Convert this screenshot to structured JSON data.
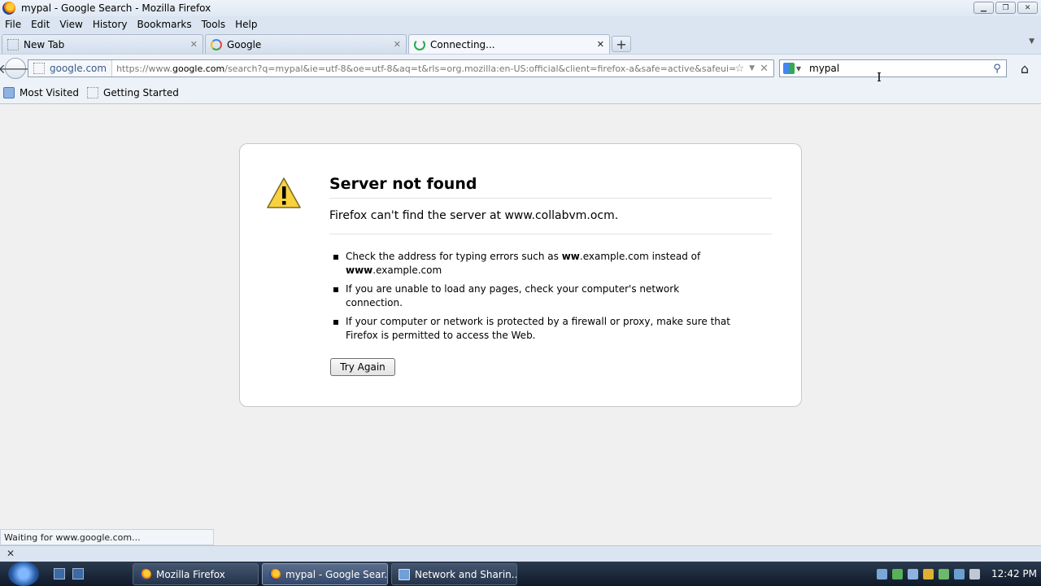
{
  "window": {
    "title": "mypal - Google Search - Mozilla Firefox"
  },
  "menu": [
    "File",
    "Edit",
    "View",
    "History",
    "Bookmarks",
    "Tools",
    "Help"
  ],
  "tabs": [
    {
      "label": "New Tab",
      "icon": "blank-page-icon"
    },
    {
      "label": "Google",
      "icon": "google-favicon-icon"
    },
    {
      "label": "Connecting...",
      "icon": "loading-spinner-icon",
      "active": true
    }
  ],
  "nav": {
    "site_identity": "google.com",
    "url_prefix": "https://www.",
    "url_domain": "google.com",
    "url_rest": "/search?q=mypal&ie=utf-8&oe=utf-8&aq=t&rls=org.mozilla:en-US:official&client=firefox-a&safe=active&safeui=or",
    "search_value": "mypal"
  },
  "bookmarks": [
    "Most Visited",
    "Getting Started"
  ],
  "error": {
    "title": "Server not found",
    "description": "Firefox can't find the server at www.collabvm.ocm.",
    "item1_a": "Check the address for typing errors such as ",
    "item1_b": "ww",
    "item1_c": ".example.com instead of ",
    "item1_d": "www",
    "item1_e": ".example.com",
    "item2": "If you are unable to load any pages, check your computer's network connection.",
    "item3": "If your computer or network is protected by a firewall or proxy, make sure that Firefox is permitted to access the Web.",
    "button": "Try Again"
  },
  "status": "Waiting for www.google.com...",
  "taskbar": {
    "tasks": [
      "Mozilla Firefox",
      "mypal - Google Sear...",
      "Network and Sharin..."
    ],
    "clock": "12:42 PM"
  },
  "colors": {
    "accent": "#3a5a8c",
    "chrome": "#dbe5f1",
    "taskbar": "#1b2a3f"
  }
}
